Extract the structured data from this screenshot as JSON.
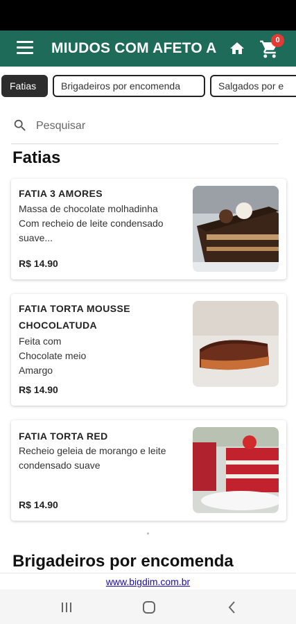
{
  "app": {
    "title": "MIUDOS COM AFETO A",
    "cart_count": "0"
  },
  "icons": {
    "menu": "hamburger-menu-icon",
    "home": "home-icon",
    "cart": "shopping-cart-icon",
    "search": "search-icon",
    "nav_recents": "recents-icon",
    "nav_home": "circle-home-icon",
    "nav_back": "back-chevron-icon"
  },
  "colors": {
    "header": "#1f6b59",
    "badge": "#e53935",
    "active_tab": "#2d2d2d"
  },
  "tabs": [
    {
      "label": "Fatias",
      "active": true
    },
    {
      "label": "Brigadeiros por encomenda",
      "active": false
    },
    {
      "label": "Salgados por e",
      "active": false
    }
  ],
  "search": {
    "placeholder": "Pesquisar",
    "value": ""
  },
  "sections": [
    {
      "title": "Fatias",
      "products": [
        {
          "name": "FATIA 3 AMORES",
          "description": "Massa de chocolate molhadinha\nCom recheio de leite condensado suave...",
          "price": "R$ 14.90"
        },
        {
          "name": "FATIA TORTA MOUSSE CHOCOLATUDA",
          "description": "Feita com\nChocolate meio\nAmargo",
          "price": "R$ 14.90"
        },
        {
          "name": "FATIA TORTA RED",
          "description": "Recheio geleia de morango e leite condensado suave",
          "price": "R$ 14.90"
        }
      ]
    },
    {
      "title": "Brigadeiros por encomenda",
      "products": []
    }
  ],
  "footer": {
    "link": "www.bigdim.com.br"
  }
}
